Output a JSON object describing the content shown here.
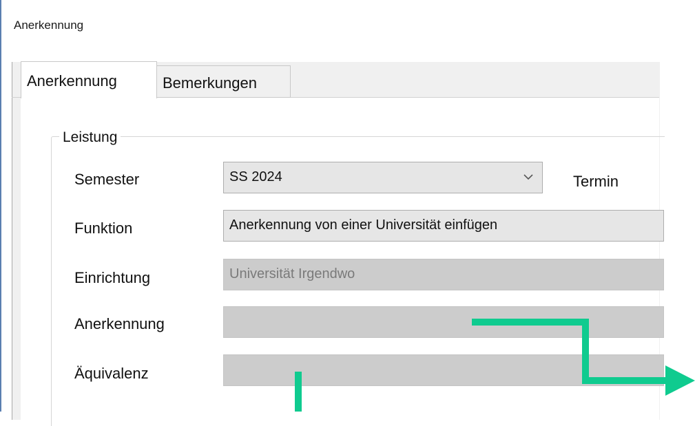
{
  "window": {
    "title": "Anerkennung"
  },
  "tabs": [
    {
      "label": "Anerkennung",
      "active": true
    },
    {
      "label": "Bemerkungen",
      "active": false
    }
  ],
  "group": {
    "title": "Leistung",
    "fields": {
      "semester": {
        "label": "Semester",
        "value": "SS 2024",
        "type": "dropdown"
      },
      "termin": {
        "label": "Termin"
      },
      "funktion": {
        "label": "Funktion",
        "value": "Anerkennung von einer Universität einfügen"
      },
      "einrichtung": {
        "label": "Einrichtung",
        "value": "Universität Irgendwo",
        "disabled": true
      },
      "anerkennung": {
        "label": "Anerkennung",
        "value": "",
        "disabled": true
      },
      "aequivalenz": {
        "label": "Äquivalenz",
        "value": "",
        "disabled": true
      }
    }
  },
  "icons": {
    "dropdown": "chevron-down-icon"
  },
  "colors": {
    "annotation_arrow": "#0fcb8f",
    "disabled_field": "#cccccc",
    "window_border": "#5a7fb0"
  }
}
